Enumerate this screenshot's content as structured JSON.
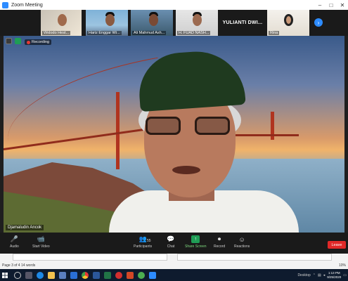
{
  "window": {
    "title": "Zoom Meeting",
    "controls": [
      "–",
      "□",
      "✕"
    ]
  },
  "participants": [
    {
      "name": "Widodo Hest...",
      "mode": "video"
    },
    {
      "name": "Hariz Enggar Wi...",
      "mode": "video"
    },
    {
      "name": "Ali Mahmud Ash...",
      "mode": "video"
    },
    {
      "name": "H. FUAD NASH...",
      "mode": "video"
    },
    {
      "name": "YULIANTI DWI...",
      "mode": "text"
    },
    {
      "name": "Rina",
      "mode": "video"
    }
  ],
  "recording": {
    "label": "Recording"
  },
  "speaker": {
    "name": "Djamaludin Ancok"
  },
  "controls": {
    "audio": "Audio",
    "start_video": "Start Video",
    "participants": "Participants",
    "participants_count": "55",
    "chat": "Chat",
    "share_screen": "Share Screen",
    "record": "Record",
    "reactions": "Reactions",
    "leave": "Leave"
  },
  "word_status": {
    "page": "Page 3 of 4",
    "words": "14 words",
    "zoom": "10%"
  },
  "taskbar": {
    "desktop_label": "Desktop",
    "time": "1:13 PM",
    "date": "9/25/2020",
    "icons": [
      "search-icon",
      "task-view-icon",
      "edge-icon",
      "file-explorer-icon",
      "store-icon",
      "mail-icon",
      "chrome-icon",
      "word-icon",
      "excel-icon",
      "opera-icon",
      "powerpoint-icon",
      "green-app-icon",
      "zoom-icon"
    ]
  },
  "colors": {
    "accent": "#2d8cff",
    "leave": "#e02828",
    "share": "#1f9d55",
    "taskbar": "#0e1b2e"
  }
}
